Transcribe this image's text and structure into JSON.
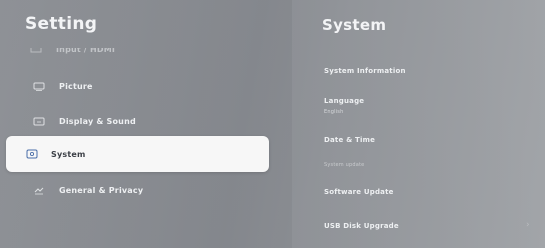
{
  "header": {
    "title": "Setting"
  },
  "left_menu": {
    "partial_item": {
      "label": "Input / HDMI",
      "icon": "input-icon"
    },
    "items": [
      {
        "label": "Picture",
        "icon": "picture-icon"
      },
      {
        "label": "Display & Sound",
        "icon": "display-sound-icon"
      },
      {
        "label": "System",
        "icon": "system-icon",
        "selected": true
      },
      {
        "label": "General & Privacy",
        "icon": "general-privacy-icon"
      }
    ]
  },
  "right_panel": {
    "title": "System",
    "items": [
      {
        "label": "System Information"
      },
      {
        "label": "Language",
        "value": "English"
      },
      {
        "label": "Date & Time"
      },
      {
        "label": "System update",
        "style": "subtle"
      },
      {
        "label": "Software Update"
      },
      {
        "label": "USB Disk Upgrade"
      }
    ],
    "chevron_icon": "chevron-right-icon"
  },
  "colors": {
    "selection_bg": "#f7f7f7",
    "selected_text": "#3b3f46",
    "text": "#eef0f2"
  }
}
